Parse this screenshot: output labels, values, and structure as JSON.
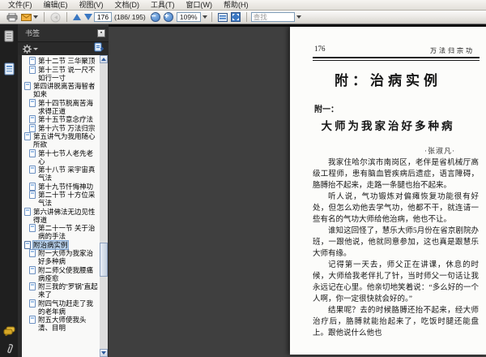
{
  "menu": {
    "items": [
      "文件(F)",
      "编辑(E)",
      "视图(V)",
      "文档(D)",
      "工具(T)",
      "窗口(W)",
      "帮助(H)"
    ]
  },
  "toolbar": {
    "page_number": "176",
    "page_count_text": "(186/ 195)",
    "zoom_level": "109%",
    "search_placeholder": "查找"
  },
  "sidebar": {
    "title": "书签",
    "bookmarks": [
      {
        "label": "第十二节 三华聚顶",
        "indent": 1,
        "selected": false
      },
      {
        "label": "第十三节 说一尺不如行一寸",
        "indent": 1,
        "selected": false
      },
      {
        "label": "第四讲脱离苦海智者如来",
        "indent": 0,
        "selected": false
      },
      {
        "label": "第十四节脱离苦海求得正道",
        "indent": 1,
        "selected": false
      },
      {
        "label": "第十五节意念疗法",
        "indent": 1,
        "selected": false
      },
      {
        "label": "第十六节 万法归宗",
        "indent": 1,
        "selected": false
      },
      {
        "label": "第五讲气为我用随心所欲",
        "indent": 0,
        "selected": false
      },
      {
        "label": "第十七节人老先老心",
        "indent": 1,
        "selected": false
      },
      {
        "label": "第十八节 采宇宙真气法",
        "indent": 1,
        "selected": false
      },
      {
        "label": "第十九节忏悔神功",
        "indent": 1,
        "selected": false
      },
      {
        "label": "第二十节 十方位采气法",
        "indent": 1,
        "selected": false
      },
      {
        "label": "第六讲佛法无边见性得道",
        "indent": 0,
        "selected": false
      },
      {
        "label": "第二十一节 关于治病的手法",
        "indent": 1,
        "selected": false
      },
      {
        "label": "附治病实例",
        "indent": 0,
        "selected": true
      },
      {
        "label": "附一大师为我家治好多种病",
        "indent": 1,
        "selected": false
      },
      {
        "label": "附二师父使我腰痛病痊愈",
        "indent": 1,
        "selected": false
      },
      {
        "label": "附三我的“罗锅”直起来了",
        "indent": 1,
        "selected": false
      },
      {
        "label": "附四气功赶走了我的老年病",
        "indent": 1,
        "selected": false
      },
      {
        "label": "附五大师使我头清、目明",
        "indent": 1,
        "selected": false
      }
    ]
  },
  "page": {
    "header_left": "176",
    "header_right": "万法归宗功",
    "title": "附：治病实例",
    "sub_label": "附一：",
    "section_title": "大师为我家治好多种病",
    "author": "·张淑凡·",
    "paragraphs": [
      "我家住哈尔滨市南岗区，老伴是省机械厅高级工程师，患有脑血管疾病后遗症，语言障碍，胳膊抬不起来，走路一条腿也抬不起来。",
      "听人说，气功锻炼对偏瘫恢复功能很有好处，但怎么劝他去学气功，他都不干，就连请一些有名的气功大师给他治病，他也不让。",
      "谁知这回怪了，慧乐大师5月份在省京剧院办班，一跟他说，他就同意参加，这也真是跟慧乐大师有缘。",
      "记得第一天去，师父正在讲课，休息的时候，大师给我老伴扎了针，当时师父一句话让我永远记在心里。他亲切地笑着说：“多么好的一个人啊，你一定很快就会好的。”",
      "结果呢？去的时候胳膊还抬不起来，经大师治疗后，胳膊就能抬起来了，吃饭时腿还能盘上。跟他说什么他也"
    ]
  },
  "colors": {
    "accent_blue": "#3a77c2",
    "selection_blue": "#b9d2ec",
    "comments_yellow": "#d8a826",
    "app_background": "#3f3f3f",
    "toolbar_background": "#e4e1db",
    "page_background": "#fcfcfa"
  }
}
